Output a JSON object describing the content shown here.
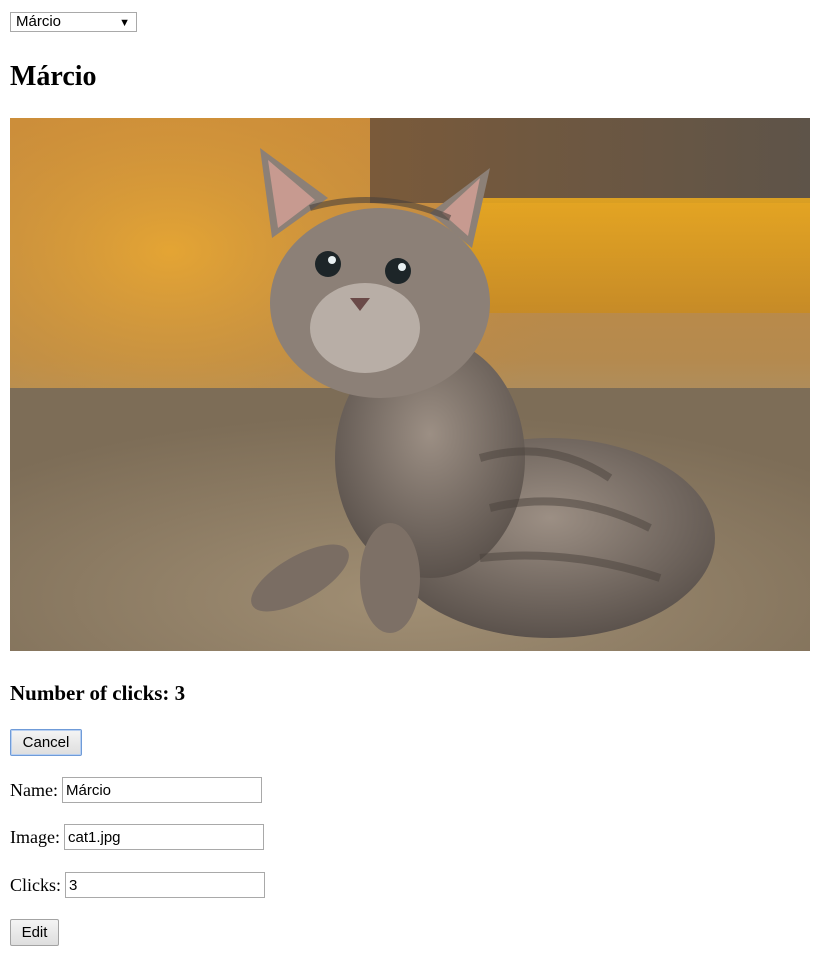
{
  "select": {
    "selected": "Márcio"
  },
  "cat": {
    "name": "Márcio",
    "image_alt": "kitten"
  },
  "clicks": {
    "heading": "Number of clicks: 3"
  },
  "buttons": {
    "cancel": "Cancel",
    "edit": "Edit"
  },
  "form": {
    "name_label": "Name:",
    "name_value": "Márcio",
    "image_label": "Image:",
    "image_value": "cat1.jpg",
    "clicks_label": "Clicks:",
    "clicks_value": "3"
  },
  "icons": {
    "dropdown": "dropdown-triangle-icon"
  }
}
